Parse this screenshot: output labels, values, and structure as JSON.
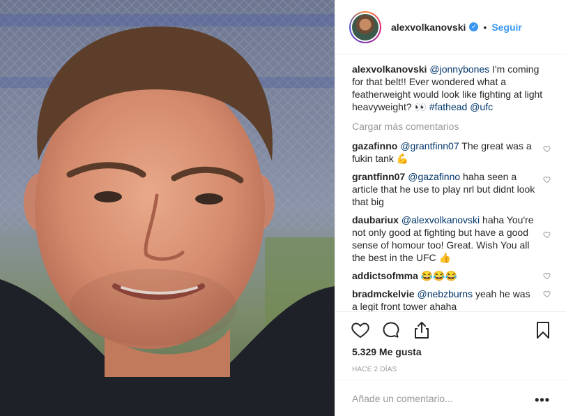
{
  "post": {
    "username": "alexvolkanovski",
    "follow_label": "Seguir",
    "separator": "•",
    "verified_mark": "✓",
    "caption": {
      "user": "alexvolkanovski",
      "mention": "@jonnybones",
      "text": " I'm coming for that belt!! Ever wondered what a featherweight would look like fighting at light heavyweight? 👀 ",
      "hashtag": "#fathead",
      "tag": "@ufc"
    },
    "load_more_label": "Cargar más comentarios",
    "comments": [
      {
        "user": "gazafinno",
        "mention": "@grantfinn07",
        "text": " The great was a fukin tank 💪"
      },
      {
        "user": "grantfinn07",
        "mention": "@gazafinno",
        "text": " haha seen a article that he use to play nrl but didnt look that big"
      },
      {
        "user": "daubariux",
        "mention": "@alexvolkanovski",
        "text": " haha You're not only good at fighting but have a good sense of homour too! Great. Wish You all the best in the UFC 👍"
      },
      {
        "user": "addictsofmma",
        "mention": "",
        "text": "😂😂😂"
      },
      {
        "user": "bradmckelvie",
        "mention": "@nebzburns",
        "text": " yeah he was a legit front tower ahaha"
      }
    ],
    "likes_label": "5.329 Me gusta",
    "time_label": "HACE 2 DÍAS",
    "add_comment_placeholder": "Añade un comentario...",
    "more_label": "•••"
  },
  "icons": {
    "heart": "heart-icon",
    "comment": "comment-icon",
    "share": "share-icon",
    "bookmark": "bookmark-icon",
    "verified": "verified-badge-icon"
  },
  "colors": {
    "link_blue": "#3897f0",
    "mention_blue": "#003569",
    "muted_gray": "#999999",
    "text": "#262626"
  }
}
